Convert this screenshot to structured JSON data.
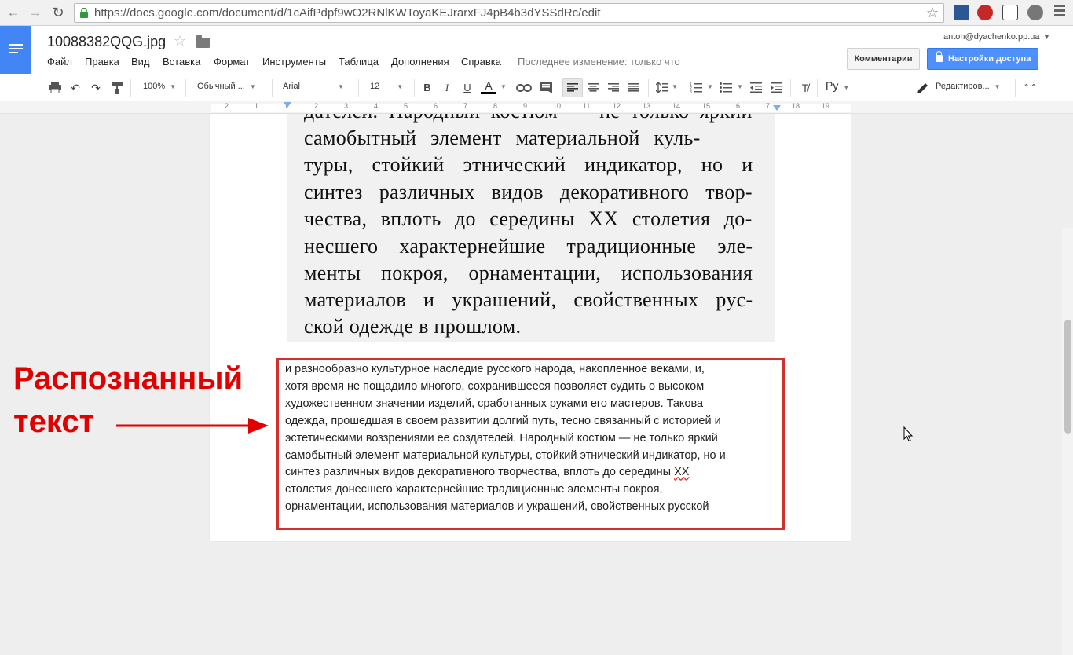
{
  "browser": {
    "url": "https://docs.google.com/document/d/1cAifPdpf9wO2RNlKWToyaKEJrarxFJ4pB4b3dYSSdRc/edit",
    "back_icon": "back-arrow-icon",
    "forward_icon": "forward-arrow-icon",
    "reload_icon": "reload-icon",
    "bookmark_icon": "star-icon"
  },
  "docs": {
    "title": "10088382QQG.jpg",
    "menu": [
      "Файл",
      "Правка",
      "Вид",
      "Вставка",
      "Формат",
      "Инструменты",
      "Таблица",
      "Дополнения",
      "Справка"
    ],
    "last_edit": "Последнее изменение: только что",
    "account": "anton@dyachenko.pp.ua",
    "comments_label": "Комментарии",
    "share_label": "Настройки доступа"
  },
  "toolbar": {
    "zoom": "100%",
    "style": "Обычный ...",
    "font": "Arial",
    "size": "12",
    "language": "Ру",
    "mode": "Редактиров..."
  },
  "ruler": {
    "numbers": [
      "2",
      "1",
      "1",
      "2",
      "3",
      "4",
      "5",
      "6",
      "7",
      "8",
      "9",
      "10",
      "11",
      "12",
      "13",
      "14",
      "15",
      "16",
      "17",
      "18",
      "19"
    ]
  },
  "scan_text": [
    "дателей. Народный костюм — не только яркий",
    "самобытный   элемент   материальной   куль-",
    "туры, стойкий этнический индикатор, но и",
    "синтез различных видов декоративного твор-",
    "чества, вплоть до середины XX столетия до-",
    "несшего характернейшие традиционные эле-",
    "менты покроя, орнаментации, использования",
    "материалов и украшений, свойственных рус-",
    "ской одежде в прошлом."
  ],
  "ocr_text": [
    "и разнообразно культурное наследие русского народа, накопленное веками, и,",
    "хотя время не пощадило многого, сохранившееся позволяет судить о высоком",
    "художественном значении изделий, сработанных руками его мастеров. Такова",
    "одежда, прошедшая в своем развитии долгий путь, тесно связанный с историей и",
    "эстетическими воззрениями ее создателей. Народный костюм — не только яркий",
    "самобытный элемент материальной культуры, стойкий этнический индикатор, но и"
  ],
  "ocr_line7_before": "синтез различных видов декоративного творчества, вплоть до середины ",
  "ocr_line7_flag": "XX",
  "ocr_tail": [
    "столетия донесшего характернейшие традиционные элементы покроя,",
    "орнаментации, использования материалов и украшений, свойственных русской"
  ],
  "annotation": {
    "line1": "Распознанный",
    "line2": "текст",
    "color": "#e00000"
  }
}
